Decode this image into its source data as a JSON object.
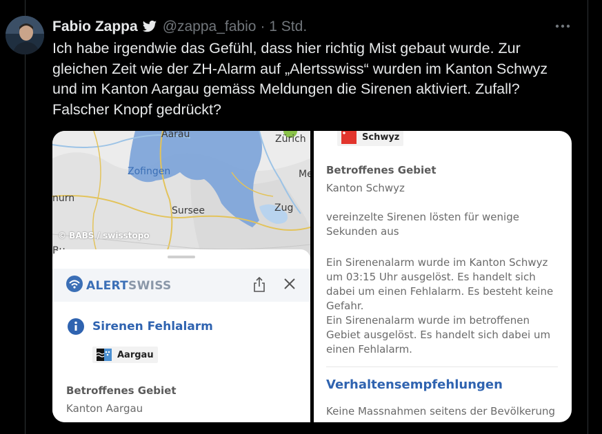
{
  "tweet": {
    "author_name": "Fabio Zappa",
    "handle": "@zappa_fabio",
    "time": "· 1 Std.",
    "text": "Ich habe irgendwie das Gefühl, dass hier richtig Mist gebaut wurde. Zur\ngleichen Zeit wie der ZH-Alarm auf „Alertsswiss“ wurden im Kanton Schwyz\nund im Kanton Aargau gemäss Meldungen die Sirenen aktiviert. Zufall?\nFalscher Knopf gedrückt?",
    "more_icon": "more-horizontal-icon",
    "verified_icon": "twitter-bird-icon"
  },
  "left_screenshot": {
    "map": {
      "labels": [
        "Aarau",
        "Zürich",
        "Zofingen",
        "Me",
        "nurn",
        "Sursee",
        "Zug",
        "Bu"
      ],
      "attribution": "© BABS / swisstopo"
    },
    "brand_a": "ALERT",
    "brand_b": "SWISS",
    "alarm_title": "Sirenen Fehlalarm",
    "canton": "Aargau",
    "section_label": "Betroffenes Gebiet",
    "section_value": "Kanton Aargau",
    "colors": {
      "accent": "#2f63b0",
      "affected_area": "#7ba3d9"
    }
  },
  "right_screenshot": {
    "canton": "Schwyz",
    "section_label": "Betroffenes Gebiet",
    "section_value": "Kanton Schwyz",
    "paragraph_1": "vereinzelte Sirenen lösten für wenige Sekunden aus",
    "paragraph_2": "Ein Sirenenalarm wurde im Kanton Schwyz um 03:15 Uhr ausgelöst. Es handelt sich dabei um einen Fehlalarm. Es besteht keine Gefahr.",
    "paragraph_3": "Ein Sirenenalarm wurde im betroffenen Gebiet ausgelöst. Es handelt sich dabei um einen Fehlalarm.",
    "recommendations_title": "Verhaltensempfehlungen",
    "recommendations_text": "Keine Massnahmen seitens der Bevölkerung"
  }
}
